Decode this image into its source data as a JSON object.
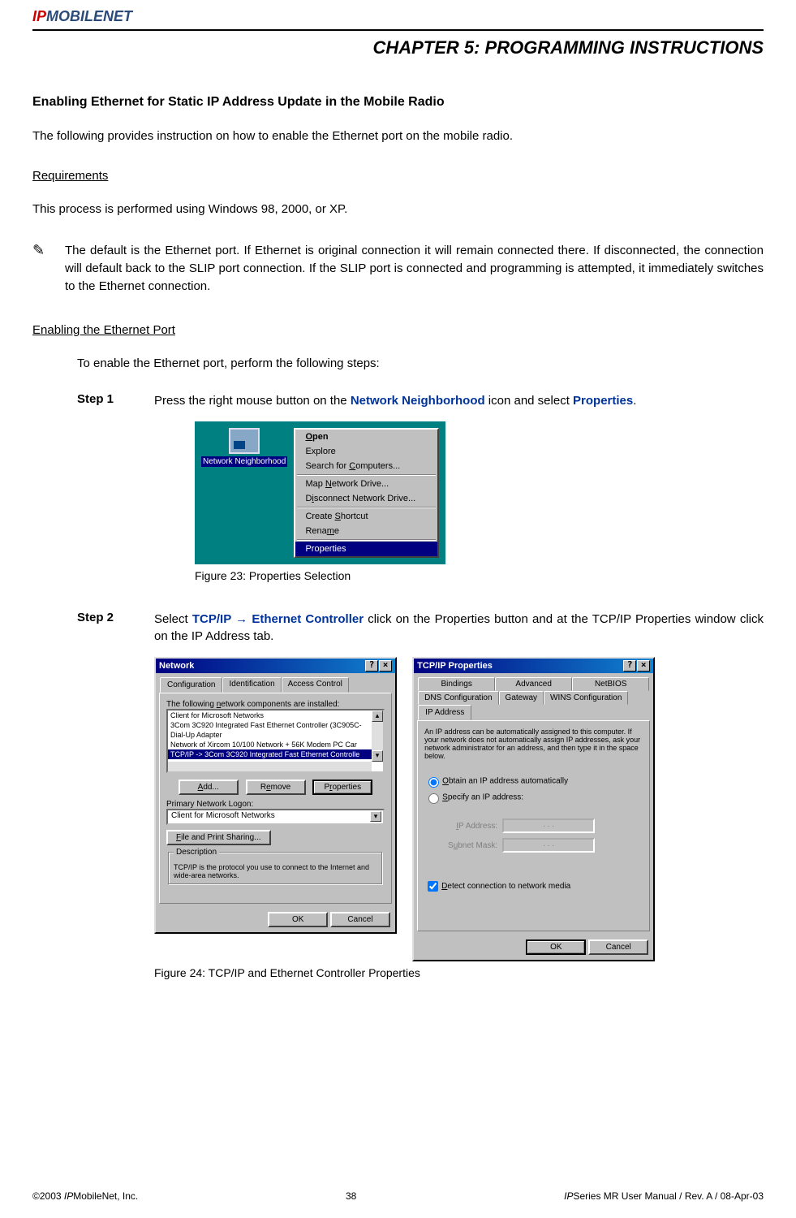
{
  "logo": {
    "ip": "IP",
    "mobile": "MOBILE",
    "net": "NET"
  },
  "chapter": "CHAPTER 5:  PROGRAMMING INSTRUCTIONS",
  "section_title": "Enabling Ethernet for Static IP Address Update in the Mobile Radio",
  "intro": "The following provides instruction on how to enable the Ethernet port on the mobile radio.",
  "requirements_heading": "Requirements",
  "requirements_text": "This process is performed using Windows 98, 2000, or XP.",
  "note_icon": "✎",
  "note_text": "The default is the Ethernet port.  If Ethernet is original connection it will remain connected there.  If disconnected, the connection will default back to the SLIP port connection.  If the SLIP port is connected and programming is attempted, it immediately switches to the Ethernet connection.",
  "enabling_heading": "Enabling the Ethernet Port",
  "enabling_intro": "To enable the Ethernet port, perform the following steps:",
  "step1": {
    "label": "Step 1",
    "pre": "Press the right mouse button on the ",
    "kw1": "Network Neighborhood",
    "mid": " icon and select ",
    "kw2": "Properties",
    "post": "."
  },
  "figure23": {
    "icon_label": "Network Neighborhood",
    "menu_items": {
      "open": "Open",
      "explore": "Explore",
      "search": "Search for Computers...",
      "map": "Map Network Drive...",
      "disconnect": "Disconnect Network Drive...",
      "shortcut": "Create Shortcut",
      "rename": "Rename",
      "properties": "Properties"
    },
    "caption": "Figure 23: Properties Selection"
  },
  "step2": {
    "label": "Step 2",
    "pre": "Select ",
    "kw": "TCP/IP → Ethernet Controller",
    "post": " click on the Properties button and at the TCP/IP Properties window click on the IP Address tab."
  },
  "figure24": {
    "network_dialog": {
      "title": "Network",
      "tabs": [
        "Configuration",
        "Identification",
        "Access Control"
      ],
      "label": "The following network components are installed:",
      "items": [
        "Client for Microsoft Networks",
        "3Com 3C920 Integrated Fast Ethernet Controller (3C905C-",
        "Dial-Up Adapter",
        "Network of Xircom 10/100 Network + 56K Modem PC Car",
        "TCP/IP -> 3Com 3C920 Integrated Fast Ethernet Controlle"
      ],
      "add": "Add...",
      "remove": "Remove",
      "properties": "Properties",
      "primary_logon": "Primary Network Logon:",
      "logon_value": "Client for Microsoft Networks",
      "file_print": "File and Print Sharing...",
      "desc_label": "Description",
      "desc_text": "TCP/IP is the protocol you use to connect to the Internet and wide-area networks.",
      "ok": "OK",
      "cancel": "Cancel"
    },
    "tcpip_dialog": {
      "title": "TCP/IP Properties",
      "tabs_row1": [
        "Bindings",
        "Advanced",
        "NetBIOS"
      ],
      "tabs_row2": [
        "DNS Configuration",
        "Gateway",
        "WINS Configuration",
        "IP Address"
      ],
      "desc": "An IP address can be automatically assigned to this computer. If your network does not automatically assign IP addresses, ask your network administrator for an address, and then type it in the space below.",
      "radio1": "Obtain an IP address automatically",
      "radio2": "Specify an IP address:",
      "ip_label": "IP Address:",
      "subnet_label": "Subnet Mask:",
      "ip_dots": ".     .     .",
      "detect": "Detect connection to network media",
      "ok": "OK",
      "cancel": "Cancel"
    },
    "caption": "Figure 24: TCP/IP and Ethernet Controller Properties"
  },
  "footer": {
    "left_copyright": "©2003 ",
    "left_ip": "IP",
    "left_rest": "MobileNet, Inc.",
    "center": "38",
    "right_ip": "IP",
    "right_rest": "Series MR User Manual / Rev. A / 08-Apr-03"
  }
}
